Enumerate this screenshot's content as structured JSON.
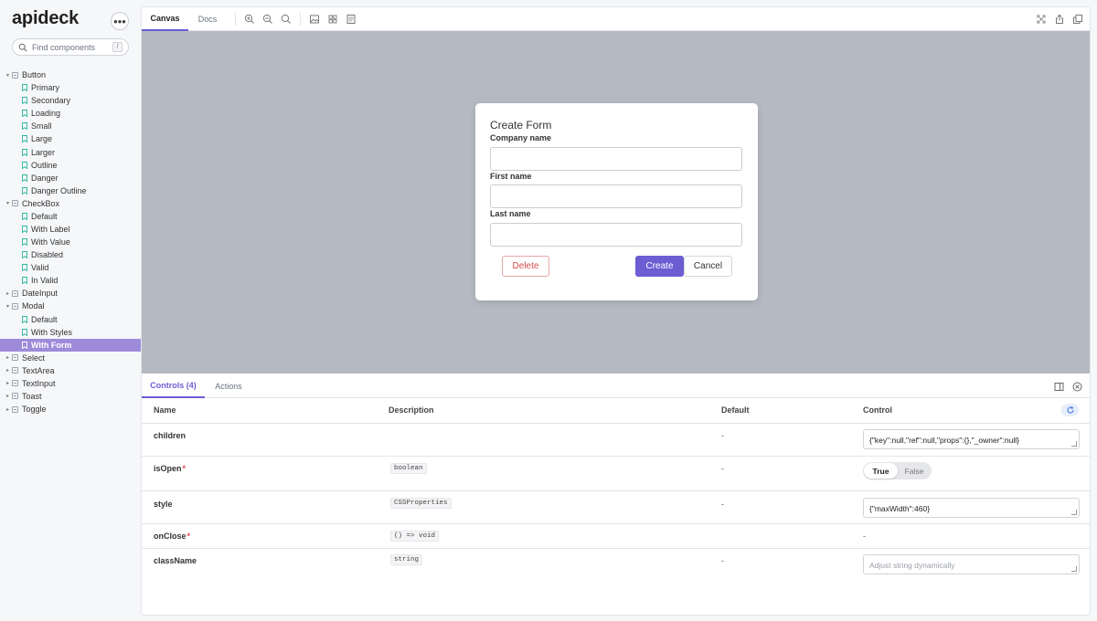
{
  "app": {
    "brand": "apideck",
    "menu_icon": "ellipsis-icon"
  },
  "search": {
    "placeholder": "Find components",
    "shortcut": "/"
  },
  "tree": [
    {
      "type": "group",
      "label": "Button",
      "expanded": true
    },
    {
      "type": "story",
      "label": "Primary"
    },
    {
      "type": "story",
      "label": "Secondary"
    },
    {
      "type": "story",
      "label": "Loading"
    },
    {
      "type": "story",
      "label": "Small"
    },
    {
      "type": "story",
      "label": "Large"
    },
    {
      "type": "story",
      "label": "Larger"
    },
    {
      "type": "story",
      "label": "Outline"
    },
    {
      "type": "story",
      "label": "Danger"
    },
    {
      "type": "story",
      "label": "Danger Outline"
    },
    {
      "type": "group",
      "label": "CheckBox",
      "expanded": true
    },
    {
      "type": "story",
      "label": "Default"
    },
    {
      "type": "story",
      "label": "With Label"
    },
    {
      "type": "story",
      "label": "With Value"
    },
    {
      "type": "story",
      "label": "Disabled"
    },
    {
      "type": "story",
      "label": "Valid"
    },
    {
      "type": "story",
      "label": "In Valid"
    },
    {
      "type": "group",
      "label": "DateInput",
      "expanded": false
    },
    {
      "type": "group",
      "label": "Modal",
      "expanded": true
    },
    {
      "type": "story",
      "label": "Default"
    },
    {
      "type": "story",
      "label": "With Styles"
    },
    {
      "type": "story",
      "label": "With Form",
      "active": true
    },
    {
      "type": "group",
      "label": "Select",
      "expanded": false
    },
    {
      "type": "group",
      "label": "TextArea",
      "expanded": false
    },
    {
      "type": "group",
      "label": "TextInput",
      "expanded": false
    },
    {
      "type": "group",
      "label": "Toast",
      "expanded": false
    },
    {
      "type": "group",
      "label": "Toggle",
      "expanded": false
    }
  ],
  "toolbar": {
    "tabs": [
      "Canvas",
      "Docs"
    ],
    "active_tab": "Canvas",
    "left_icons": [
      "zoom-in-icon",
      "zoom-out-icon",
      "zoom-reset-icon",
      "background-icon",
      "grid-icon",
      "outline-icon"
    ],
    "right_icons": [
      "fullscreen-icon",
      "share-icon",
      "copy-icon"
    ]
  },
  "modal": {
    "title": "Create Form",
    "fields": [
      {
        "label": "Company name",
        "value": ""
      },
      {
        "label": "First name",
        "value": ""
      },
      {
        "label": "Last name",
        "value": ""
      }
    ],
    "delete_label": "Delete",
    "create_label": "Create",
    "cancel_label": "Cancel"
  },
  "panel": {
    "tabs": [
      "Controls (4)",
      "Actions"
    ],
    "active_tab": "Controls (4)",
    "headers": {
      "name": "Name",
      "description": "Description",
      "default": "Default",
      "control": "Control"
    },
    "rows": [
      {
        "name": "children",
        "required": false,
        "description": "",
        "default": "-",
        "control_type": "text",
        "control_value": "{\"key\":null,\"ref\":null,\"props\":{},\"_owner\":null}"
      },
      {
        "name": "isOpen",
        "required": true,
        "description": "boolean",
        "default": "-",
        "control_type": "toggle",
        "true_label": "True",
        "false_label": "False",
        "value": true
      },
      {
        "name": "style",
        "required": false,
        "description": "CSSProperties",
        "default": "-",
        "control_type": "text",
        "control_value": "{\"maxWidth\":460}"
      },
      {
        "name": "onClose",
        "required": true,
        "description": "() => void",
        "default": "",
        "control_type": "none",
        "control_value": "-"
      },
      {
        "name": "className",
        "required": false,
        "description": "string",
        "default": "-",
        "control_type": "text",
        "control_placeholder": "Adjust string dynamically"
      }
    ]
  },
  "colors": {
    "accent": "#6c5dd3",
    "active_item_bg": "#9d8bd9",
    "canvas_bg": "#b5b9c1",
    "danger": "#d84b4b"
  }
}
